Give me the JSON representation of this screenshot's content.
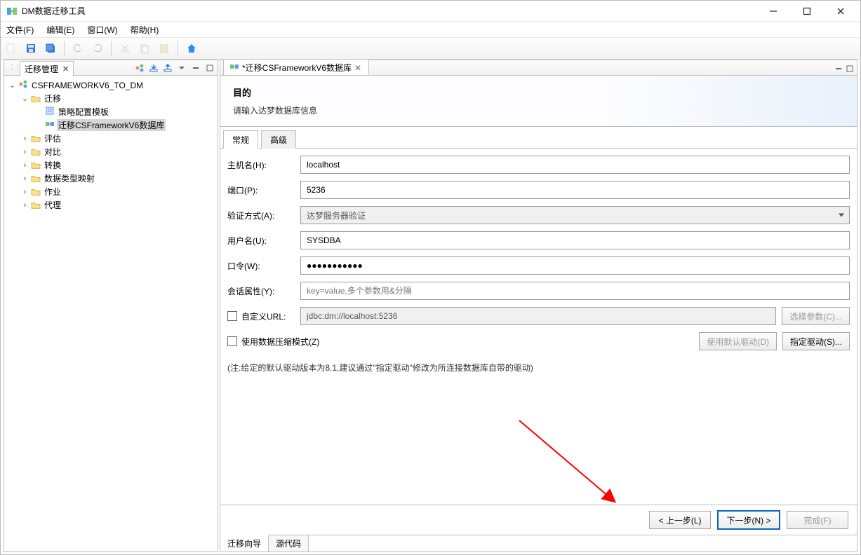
{
  "window": {
    "title": "DM数据迁移工具"
  },
  "menu": {
    "file": "文件(F)",
    "edit": "编辑(E)",
    "window": "窗口(W)",
    "help": "帮助(H)"
  },
  "sidebar": {
    "title": "迁移管理",
    "root": "CSFRAMEWORKV6_TO_DM",
    "items": {
      "migrate": "迁移",
      "policy_template": "策略配置模板",
      "migrate_task": "迁移CSFrameworkV6数据库",
      "evaluate": "评估",
      "compare": "对比",
      "convert": "转换",
      "type_mapping": "数据类型映射",
      "job": "作业",
      "agent": "代理"
    }
  },
  "editor": {
    "tab_title": "*迁移CSFrameworkV6数据库",
    "wizard_title": "目的",
    "wizard_subtitle": "请输入达梦数据库信息",
    "subtabs": {
      "general": "常规",
      "advanced": "高级"
    },
    "labels": {
      "host": "主机名(H):",
      "port": "端口(P):",
      "auth": "验证方式(A):",
      "user": "用户名(U):",
      "password": "口令(W):",
      "session": "会话属性(Y):",
      "custom_url": "自定义URL:",
      "compress": "使用数据压缩模式(Z)"
    },
    "values": {
      "host": "localhost",
      "port": "5236",
      "auth": "达梦服务器验证",
      "user": "SYSDBA",
      "password": "●●●●●●●●●●●",
      "session_placeholder": "key=value,多个参数用&分隔",
      "custom_url": "jdbc:dm://localhost:5236"
    },
    "buttons": {
      "select_params": "选择参数(C)...",
      "default_driver": "使用默认驱动(D)",
      "specify_driver": "指定驱动(S)..."
    },
    "note": "(注:给定的默认驱动版本为8.1,建议通过\"指定驱动\"修改为所连接数据库自带的驱动)"
  },
  "footer": {
    "prev": "< 上一步(L)",
    "next": "下一步(N) >",
    "finish": "完成(F)"
  },
  "bottom_tabs": {
    "wizard": "迁移向导",
    "source": "源代码"
  }
}
